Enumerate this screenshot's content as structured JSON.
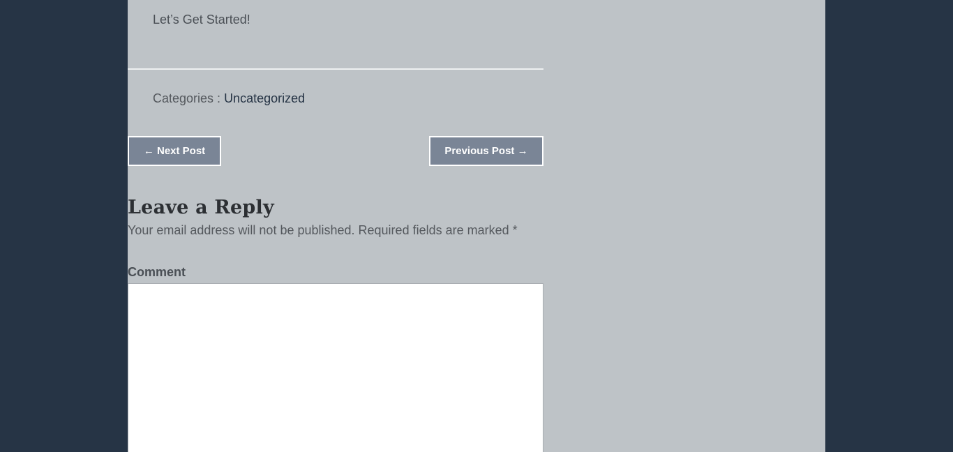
{
  "post": {
    "closing_text": "Let’s Get Started!"
  },
  "meta": {
    "categories_label": "Categories : ",
    "category": "Uncategorized"
  },
  "navigation": {
    "next_label": "← Next Post",
    "previous_label": "Previous Post →"
  },
  "reply": {
    "title": "Leave a Reply",
    "note": "Your email address will not be published. Required fields are marked ",
    "required_marker": "*",
    "comment_label": "Comment",
    "comment_value": ""
  },
  "colors": {
    "outer_background": "#263445",
    "page_background": "#bec3c7",
    "button_background": "#7a8596",
    "link": "#263445"
  }
}
